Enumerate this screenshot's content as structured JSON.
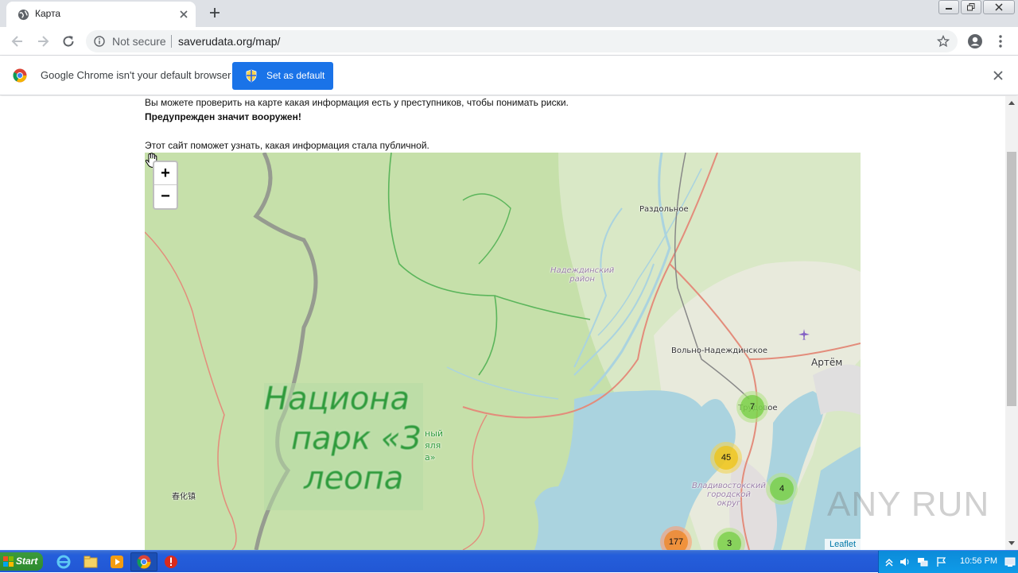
{
  "browser": {
    "tab_title": "Карта",
    "security_label": "Not secure",
    "url": "saverudata.org/map/"
  },
  "infobar": {
    "message": "Google Chrome isn't your default browser",
    "button_label": "Set as default"
  },
  "page": {
    "line1": "Вы можете проверить на карте какая информация есть у преступников, чтобы понимать риски.",
    "line2": "Предупрежден значит вооружен!",
    "line3": "Этот сайт поможет узнать, какая информация стала публичной."
  },
  "map": {
    "zoom_in": "+",
    "zoom_out": "−",
    "attribution": "Leaflet",
    "park_label_lines": [
      "Национа",
      "парк «З",
      "леопа"
    ],
    "park_small_lines": [
      "ный",
      "яля",
      "а»"
    ],
    "places": {
      "razdolnoe": "Раздольное",
      "nadezhdinsky": "Надеждинский\nрайон",
      "volno": "Вольно-Надеждинское",
      "artem": "Артём",
      "trudovoe": "Трудовое",
      "vladivostok": "Владивостокский\nгородской\nокруг",
      "chunhua": "春化镇"
    },
    "clusters": [
      {
        "label": "7",
        "color": "green"
      },
      {
        "label": "45",
        "color": "yellow"
      },
      {
        "label": "4",
        "color": "green"
      },
      {
        "label": "177",
        "color": "orange"
      },
      {
        "label": "3",
        "color": "green"
      }
    ]
  },
  "watermark": "ANY RUN",
  "taskbar": {
    "start_label": "Start",
    "clock": "10:56 PM"
  }
}
